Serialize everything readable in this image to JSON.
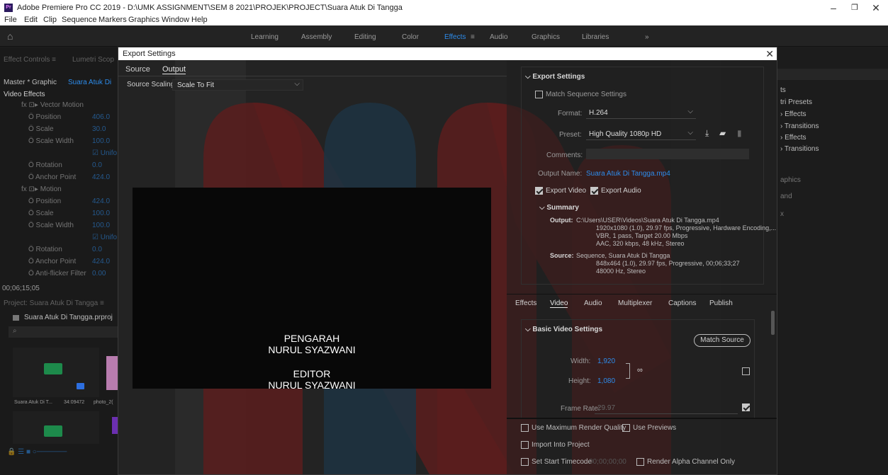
{
  "window": {
    "title": "Adobe Premiere Pro CC 2019 - D:\\UMK ASSIGNMENT\\SEM 8 2021\\PROJEK\\PROJECT\\Suara Atuk Di Tangga",
    "app_icon": "Pr",
    "minimize": "–",
    "maximize": "❐",
    "close": "✕"
  },
  "menu": [
    "File",
    "Edit",
    "Clip",
    "Sequence",
    "Markers",
    "Graphics",
    "Window",
    "Help"
  ],
  "workspaces": [
    "Learning",
    "Assembly",
    "Editing",
    "Color",
    "Effects",
    "≡",
    "Audio",
    "Graphics",
    "Libraries",
    "»"
  ],
  "workspace_active": "Effects",
  "effect_controls": {
    "tabs": [
      "Effect Controls ≡",
      "Lumetri Scop"
    ],
    "master": "Master * Graphic",
    "clip": "Suara Atuk Di",
    "video_effects": "Video Effects",
    "rows": [
      {
        "label": "fx ⊡▸ Vector Motion",
        "val": ""
      },
      {
        "label": "Ö Position",
        "val": "406.0"
      },
      {
        "label": "Ö Scale",
        "val": "30.0"
      },
      {
        "label": "Ö Scale Width",
        "val": "100.0"
      },
      {
        "label": "",
        "val": "☑ Unifo"
      },
      {
        "label": "Ö Rotation",
        "val": "0.0"
      },
      {
        "label": "Ö Anchor Point",
        "val": "424.0"
      },
      {
        "label": "fx ⊡▸ Motion",
        "val": ""
      },
      {
        "label": "Ö Position",
        "val": "424.0"
      },
      {
        "label": "Ö Scale",
        "val": "100.0"
      },
      {
        "label": "Ö Scale Width",
        "val": "100.0"
      },
      {
        "label": "",
        "val": "☑ Unifo"
      },
      {
        "label": "Ö Rotation",
        "val": "0.0"
      },
      {
        "label": "Ö Anchor Point",
        "val": "424.0"
      },
      {
        "label": "Ö Anti-flicker Filter",
        "val": "0.00"
      }
    ],
    "timecode": "00;06;15;05"
  },
  "project": {
    "title": "Project: Suara Atuk Di Tangga ≡",
    "file": "Suara Atuk Di Tangga.prproj",
    "item1": "Suara Atuk Di T...",
    "item1_dur": "34:09472",
    "item2": "photo_2("
  },
  "right_panel": {
    "items": [
      "ts",
      "tri Presets",
      "› Effects",
      "› Transitions",
      "› Effects",
      "› Transitions"
    ],
    "dim_items": [
      "aphics",
      "and",
      "x"
    ]
  },
  "dialog": {
    "title": "Export Settings",
    "close": "✕",
    "tabs": [
      "Source",
      "Output"
    ],
    "active_tab": "Output",
    "source_scaling_label": "Source Scaling:",
    "source_scaling_value": "Scale To Fit",
    "credits": [
      "PENGARAH",
      "NURUL SYAZWANI",
      "EDITOR",
      "NURUL SYAZWANI"
    ],
    "export": {
      "header": "Export Settings",
      "match_sequence": "Match Sequence Settings",
      "format_label": "Format:",
      "format_value": "H.264",
      "preset_label": "Preset:",
      "preset_value": "High Quality 1080p HD",
      "comments_label": "Comments:",
      "output_name_label": "Output Name:",
      "output_name_value": "Suara Atuk Di Tangga.mp4",
      "export_video": "Export Video",
      "export_audio": "Export Audio",
      "summary_header": "Summary",
      "output_key": "Output:",
      "output_lines": [
        "C:\\Users\\USER\\Videos\\Suara Atuk Di Tangga.mp4",
        "1920x1080 (1.0), 29.97 fps, Progressive, Hardware Encoding,...",
        "VBR, 1 pass, Target 20.00 Mbps",
        "AAC, 320 kbps, 48 kHz, Stereo"
      ],
      "source_key": "Source:",
      "source_lines": [
        "Sequence, Suara Atuk Di Tangga",
        "848x464 (1.0), 29.97 fps, Progressive, 00;06;33;27",
        "48000 Hz, Stereo"
      ]
    },
    "subtabs": [
      "Effects",
      "Video",
      "Audio",
      "Multiplexer",
      "Captions",
      "Publish"
    ],
    "active_subtab": "Video",
    "video": {
      "header": "Basic Video Settings",
      "match_source": "Match Source",
      "width_label": "Width:",
      "width_value": "1,920",
      "height_label": "Height:",
      "height_value": "1,080",
      "frame_rate_label": "Frame Rate:",
      "frame_rate_value": "29.97"
    },
    "bottom": {
      "max_render": "Use Maximum Render Quality",
      "use_previews": "Use Previews",
      "import_project": "Import Into Project",
      "set_start_tc": "Set Start Timecode",
      "start_tc_value": "00;00;00;00",
      "render_alpha": "Render Alpha Channel Only"
    }
  }
}
